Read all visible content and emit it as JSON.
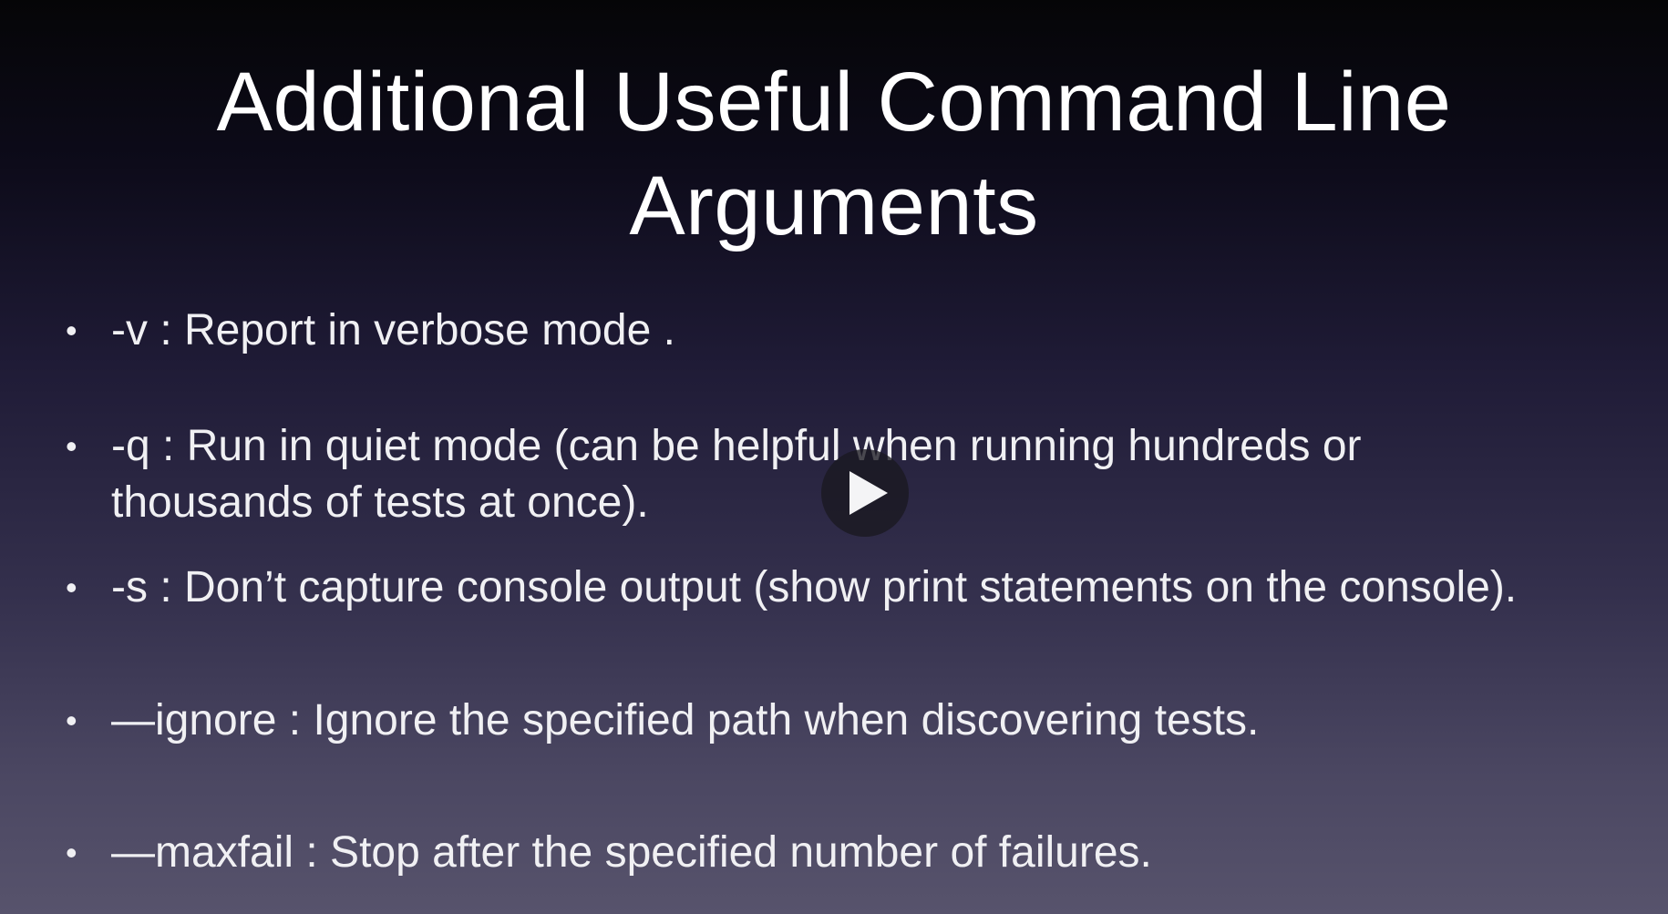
{
  "slide": {
    "title_line1": "Additional Useful Command Line",
    "title_line2": "Arguments",
    "bullets": [
      "-v : Report in verbose mode .",
      "-q : Run in quiet mode (can be helpful when running hundreds or\nthousands of tests at once).",
      "-s : Don’t capture console output (show print statements on the console).",
      "—ignore : Ignore the specified path when discovering tests.",
      "—maxfail : Stop after the specified number of failures."
    ],
    "bullet_glyph": "•"
  },
  "player": {
    "play_icon": "play-icon"
  }
}
